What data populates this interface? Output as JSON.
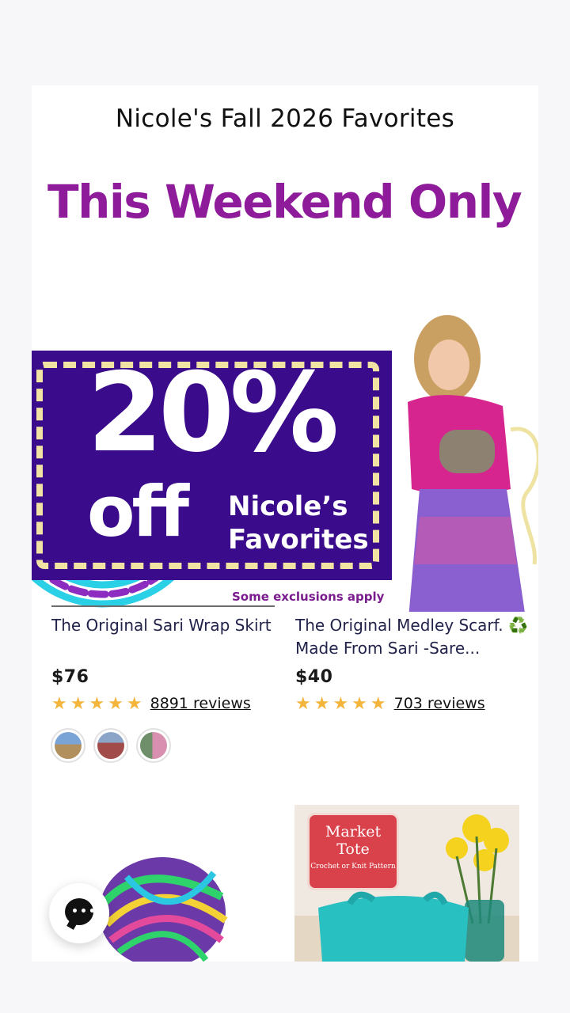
{
  "section": {
    "title": "Nicole's Fall 2026 Favorites"
  },
  "banner": {
    "headline": "This Weekend Only",
    "percent": "20%",
    "off": "off",
    "fav_line1": "Nicole’s",
    "fav_line2": "Favorites",
    "note": "Some exclusions apply"
  },
  "products": [
    {
      "title": "The Original Sari Wrap Skirt",
      "price": "$76",
      "stars": "★★★★★",
      "reviews": "8891 reviews",
      "rating": 5
    },
    {
      "title": "The Original Medley Scarf. ♻️ Made From Sari -Sare...",
      "price": "$40",
      "stars": "★★★★★",
      "reviews": "703 reviews",
      "rating": 5
    }
  ],
  "swatches": [
    {
      "name": "swatch-1",
      "colors": [
        "#5f86b8",
        "#c0a16f"
      ]
    },
    {
      "name": "swatch-2",
      "colors": [
        "#a14b4b",
        "#8aa5c7"
      ]
    },
    {
      "name": "swatch-3",
      "colors": [
        "#6f8f6a",
        "#d98fb0"
      ]
    }
  ],
  "tote_label": {
    "line1": "Market",
    "line2": "Tote",
    "line3": "Crochet or Knit Pattern"
  },
  "colors": {
    "headline": "#8e1b9a",
    "coupon_bg": "#3a0c8c",
    "coupon_dash": "#f0e3a4",
    "star": "#f3b53c",
    "tote_label_bg": "#d9424b"
  },
  "icons": {
    "chat": "chat-bubble-icon",
    "recycle": "recycle-icon"
  }
}
